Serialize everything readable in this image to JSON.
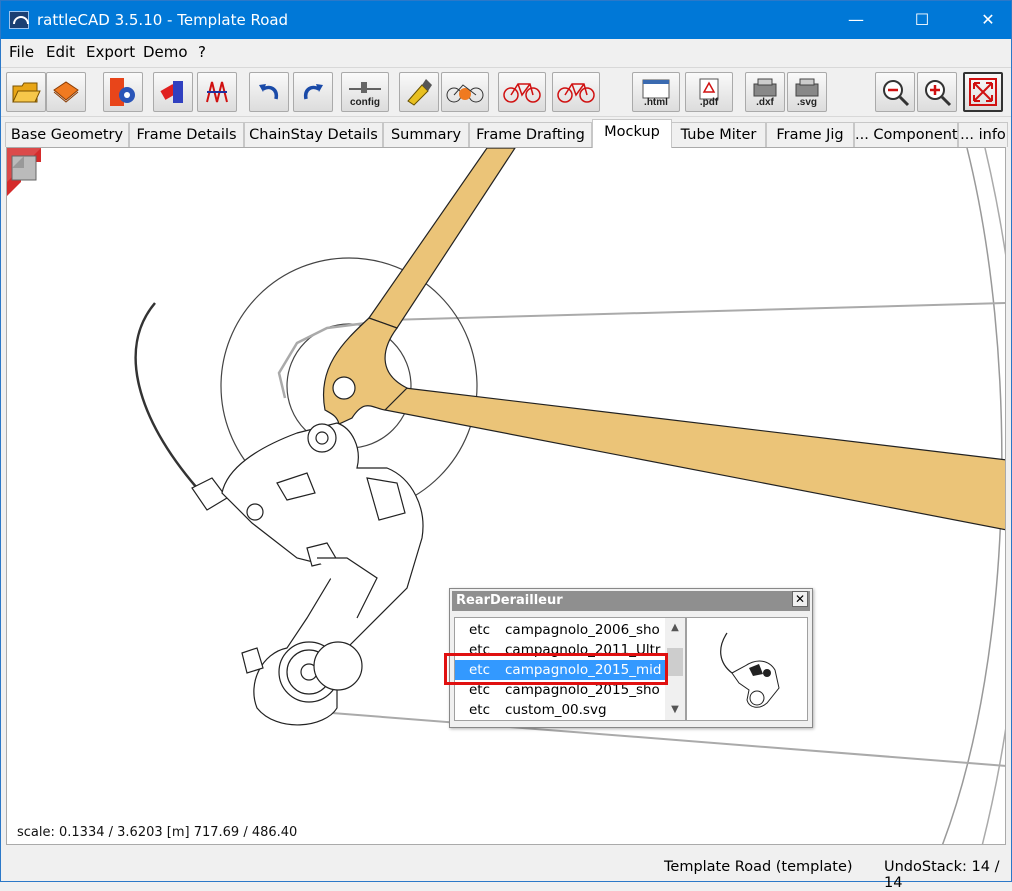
{
  "window": {
    "title": "rattleCAD  3.5.10 - Template Road",
    "controls": {
      "minimize": "—",
      "maximize": "☐",
      "close": "✕"
    }
  },
  "menu": [
    "File",
    "Edit",
    "Export",
    "Demo",
    "?"
  ],
  "toolbar": {
    "buttons": [
      "open-icon",
      "save-icon",
      "settings-icon",
      "tube-icon",
      "geometry-icon",
      "undo-icon",
      "redo-icon",
      "config-icon",
      "paint-icon",
      "bike-gear-icon",
      "bike-red-icon",
      "bike-red-2-icon",
      "html-icon",
      "pdf-icon",
      "dxf-icon",
      "svg-icon",
      "zoom-out-icon",
      "zoom-in-icon",
      "fit-icon"
    ],
    "config_label": "config",
    "html_label": ".html",
    "pdf_label": ".pdf",
    "dxf_label": ".dxf",
    "svg_label": ".svg"
  },
  "tabs": [
    "Base Geometry",
    "Frame Details",
    "ChainStay Details",
    "Summary",
    "Frame Drafting",
    "Mockup",
    "Tube Miter",
    "Frame Jig",
    "... Components",
    "... info"
  ],
  "active_tab": "Mockup",
  "canvas": {
    "scale_readout": "scale: 0.1334 / 3.6203  [m]  717.69 / 486.40"
  },
  "dialog": {
    "title": "RearDerailleur",
    "close": "✕",
    "rows": [
      {
        "category": "etc",
        "file": "campagnolo_2006_sho"
      },
      {
        "category": "etc",
        "file": "campagnolo_2011_Ultr"
      },
      {
        "category": "etc",
        "file": "campagnolo_2015_mid"
      },
      {
        "category": "etc",
        "file": "campagnolo_2015_sho"
      },
      {
        "category": "etc",
        "file": "custom_00.svg"
      }
    ],
    "selected_index": 2,
    "scroll_up": "▲",
    "scroll_down": "▼"
  },
  "status": {
    "project": "Template Road (template)",
    "undo": "UndoStack: 14 / 14"
  },
  "colors": {
    "titlebar": "#0078d7",
    "frame_tube": "#ebc478",
    "selection": "#3399ff",
    "highlight": "#e01010"
  }
}
